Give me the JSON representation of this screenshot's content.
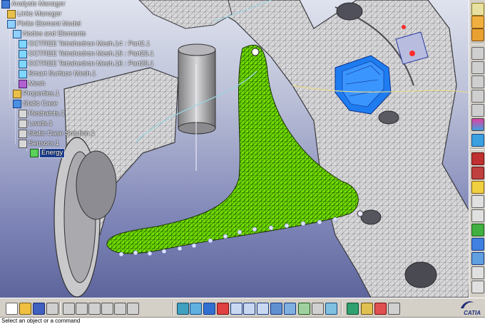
{
  "tree": {
    "items": [
      {
        "label": "Analysis Manager",
        "icon": "analysis-manager-icon"
      },
      {
        "label": "Links Manager",
        "icon": "links-manager-icon"
      },
      {
        "label": "Finite Element Model",
        "icon": "finite-element-model-icon"
      },
      {
        "label": "Nodes and Elements",
        "icon": "nodes-elements-icon"
      },
      {
        "label": "OCTREE Tetrahedron Mesh.14 : Part2.1",
        "icon": "mesh-icon"
      },
      {
        "label": "OCTREE Tetrahedron Mesh.15 : Part23.1",
        "icon": "mesh-icon"
      },
      {
        "label": "OCTREE Tetrahedron Mesh.16 : Part25.1",
        "icon": "mesh-icon"
      },
      {
        "label": "Smart Surface Mesh.1",
        "icon": "surface-mesh-icon"
      },
      {
        "label": "Mesh",
        "icon": "mesh-folder-icon"
      },
      {
        "label": "Properties.1",
        "icon": "properties-icon"
      },
      {
        "label": "Static Case",
        "icon": "static-case-icon"
      },
      {
        "label": "Restraints.1",
        "icon": "restraints-icon"
      },
      {
        "label": "Loads.1",
        "icon": "loads-icon"
      },
      {
        "label": "Static Case Solution.1",
        "icon": "solution-icon"
      },
      {
        "label": "Sensors.1",
        "icon": "sensors-icon"
      },
      {
        "label": "Energy",
        "icon": "energy-icon"
      }
    ]
  },
  "status_bar": {
    "prompt": "Select an object or a command"
  },
  "logo": {
    "text": "CATIA"
  },
  "colors": {
    "mesh_green": "#6fe000",
    "part_gray": "#d9d9db",
    "blue_clamp": "#1e7cf0",
    "background_top": "#dfe3ee",
    "background_bottom": "#5e659c"
  },
  "right_toolbar": [
    "sketcher-icon",
    "compass-icon",
    "analysis-icon",
    "line-icon",
    "curve-icon",
    "arc-icon",
    "connect-icon",
    "scale-icon",
    "color-icon",
    "restraint-icon",
    "clamp-icon",
    "load-icon",
    "pressure-icon",
    "distributed-force-icon",
    "moment-icon",
    "sensor-icon",
    "compute-icon",
    "image-icon",
    "report-icon",
    "results-icon",
    "generate-image-icon"
  ],
  "bottom_toolbar": [
    "new-icon",
    "open-icon",
    "save-icon",
    "print-icon",
    "cut-icon",
    "copy-icon",
    "paste-icon",
    "undo-icon",
    "redo-icon",
    "whats-this-icon",
    "fly-mode-icon",
    "fit-all-icon",
    "pan-icon",
    "rotate-icon",
    "zoom-in-icon",
    "zoom-out-icon",
    "normal-view-icon",
    "multi-view-icon",
    "iso-view-icon",
    "shading-icon",
    "hide-show-icon",
    "swap-visible-icon",
    "material-icon",
    "measure-icon",
    "sensor-toolbar-icon",
    "catalog-icon"
  ]
}
